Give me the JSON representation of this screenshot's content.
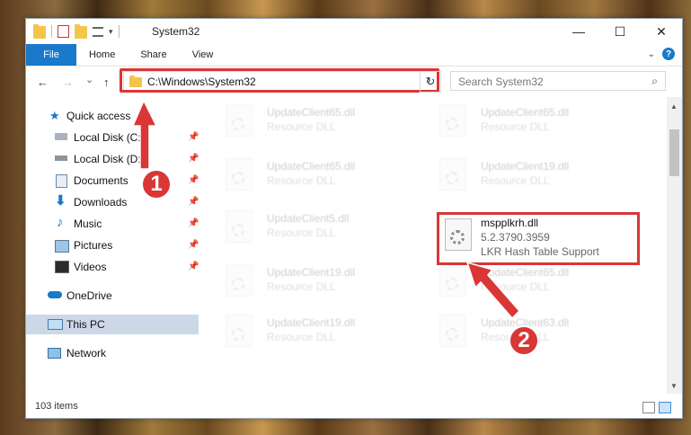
{
  "window": {
    "title": "System32"
  },
  "controls": {
    "minimize": "—",
    "maximize": "☐",
    "close": "✕"
  },
  "ribbon": {
    "tabs": [
      "File",
      "Home",
      "Share",
      "View"
    ],
    "help": "?"
  },
  "nav": {
    "back": "←",
    "forward": "→",
    "recent": "⌄",
    "up": "↑"
  },
  "address": {
    "path": "C:\\Windows\\System32",
    "dropdown": "⌄",
    "refresh": "↻"
  },
  "search": {
    "placeholder": "Search System32",
    "icon": "⌕"
  },
  "sidebar": {
    "items": [
      {
        "label": "Quick access"
      },
      {
        "label": "Local Disk (C:)"
      },
      {
        "label": "Local Disk (D:)"
      },
      {
        "label": "Documents"
      },
      {
        "label": "Downloads"
      },
      {
        "label": "Music"
      },
      {
        "label": "Pictures"
      },
      {
        "label": "Videos"
      },
      {
        "label": "OneDrive"
      },
      {
        "label": "This PC"
      },
      {
        "label": "Network"
      }
    ],
    "pin": "📌"
  },
  "files": [
    {
      "name": "UpdateClient65.dll",
      "desc": "Resource DLL"
    },
    {
      "name": "UpdateClient65.dll",
      "desc": "Resource DLL"
    },
    {
      "name": "UpdateClient65.dll",
      "desc": "Resource DLL"
    },
    {
      "name": "UpdateClient19.dll",
      "desc": "Resource DLL"
    },
    {
      "name": "UpdateClient5.dll",
      "desc": "Resource DLL"
    },
    {
      "name": "UpdateClient19.dll",
      "desc": "Resource DLL"
    },
    {
      "name": "UpdateClient65.dll",
      "desc": "Resource DLL"
    },
    {
      "name": "UpdateClient19.dll",
      "desc": "Resource DLL"
    },
    {
      "name": "UpdateClient63.dll",
      "desc": "Resource DLL"
    }
  ],
  "target_file": {
    "name": "mspplkrh.dll",
    "version": "5.2.3790.3959",
    "description": "LKR Hash Table Support"
  },
  "status": {
    "count": "103 items"
  },
  "markers": {
    "one": "1",
    "two": "2"
  },
  "colors": {
    "accent": "#1979ca",
    "highlight": "#d93636"
  }
}
